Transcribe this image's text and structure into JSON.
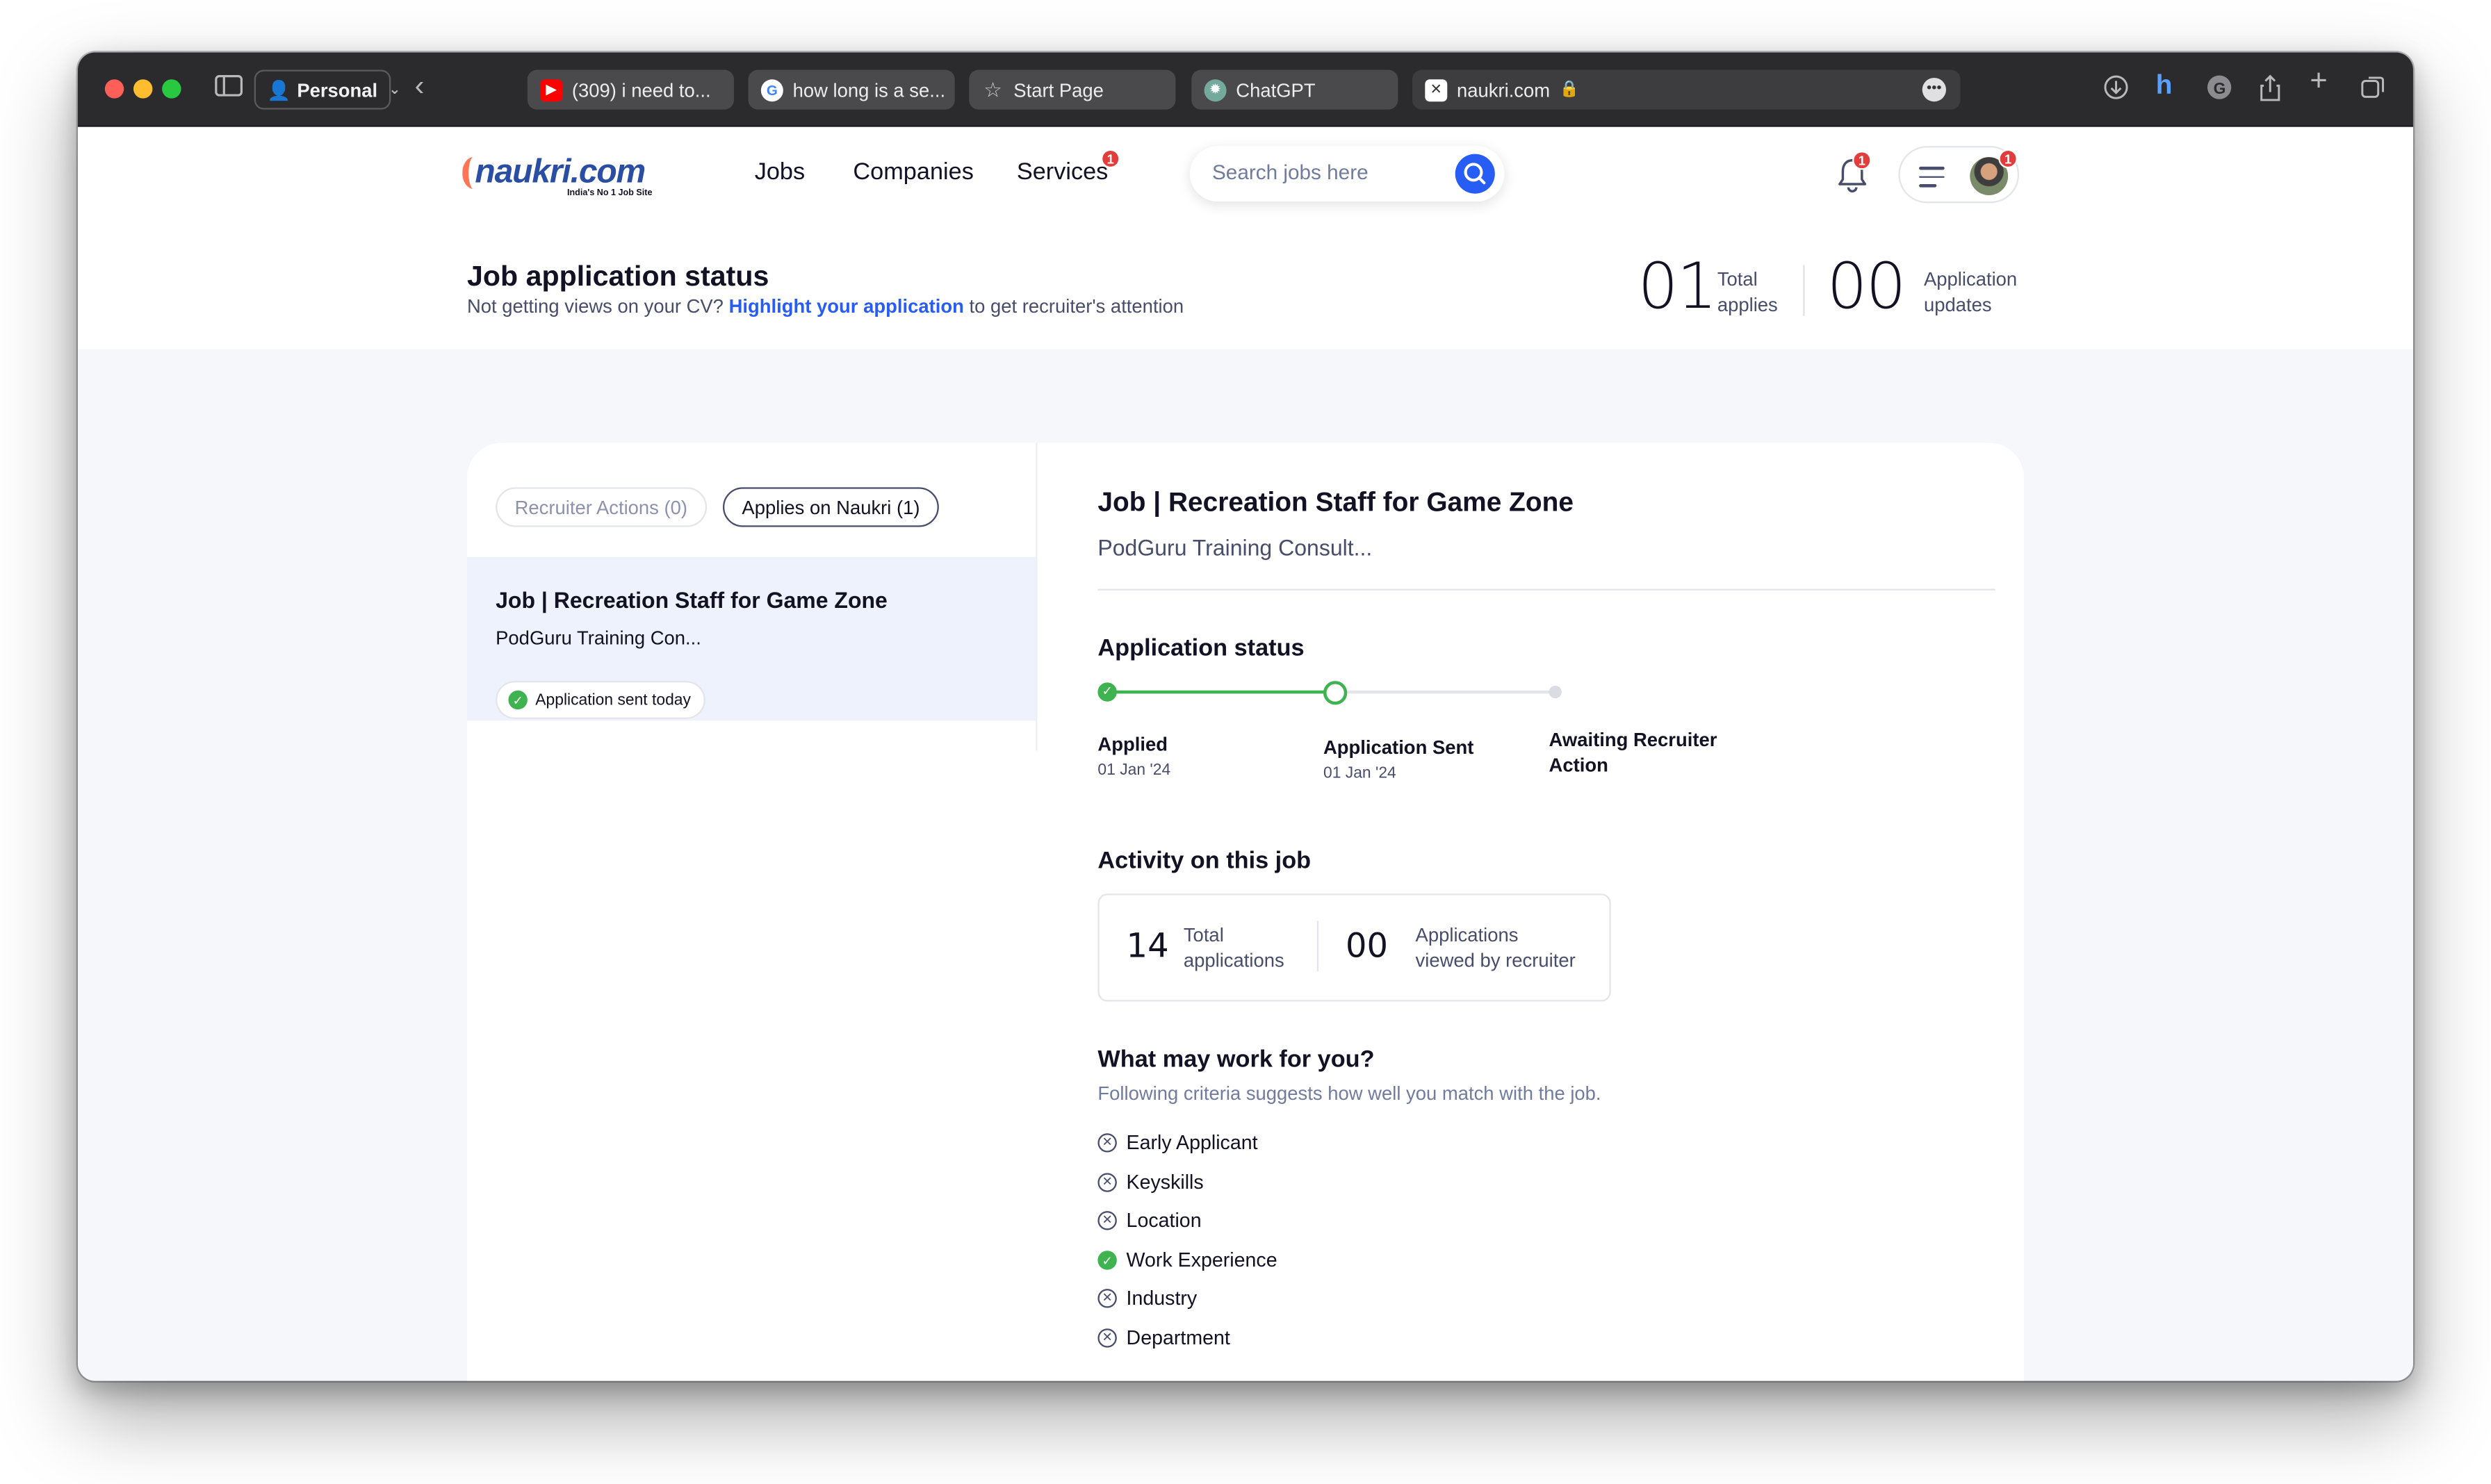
{
  "browser": {
    "profile_label": "Personal",
    "tabs": [
      {
        "label": "(309) i need to...",
        "icon": "youtube-icon",
        "color": "#ff0000"
      },
      {
        "label": "how long is a se...",
        "icon": "google-icon",
        "color": "#ffffff"
      },
      {
        "label": "Start Page",
        "icon": "star-icon",
        "color": "#bbbbbb"
      },
      {
        "label": "ChatGPT",
        "icon": "chatgpt-icon",
        "color": "#74aa9c"
      }
    ],
    "active_tab": {
      "label": "naukri.com",
      "icon": "naukri-favicon"
    }
  },
  "header": {
    "logo_text": "naukri",
    "logo_dot": ".com",
    "logo_tagline": "India's No 1 Job Site",
    "nav": [
      {
        "label": "Jobs"
      },
      {
        "label": "Companies"
      },
      {
        "label": "Services",
        "badge": "1"
      }
    ],
    "search_placeholder": "Search jobs here",
    "bell_badge": "1",
    "menu_badge": "1",
    "accent_color": "#275df5"
  },
  "status_header": {
    "title": "Job application status",
    "subtitle_pre": "Not getting views on your CV?",
    "subtitle_link": "Highlight your application",
    "subtitle_post": "to get recruiter's attention",
    "total_applies_value": "01",
    "total_applies_label1": "Total",
    "total_applies_label2": "applies",
    "updates_value": "00",
    "updates_label1": "Application",
    "updates_label2": "updates"
  },
  "filters": {
    "recruiter_actions": "Recruiter Actions (0)",
    "applies_on_naukri": "Applies on Naukri (1)"
  },
  "application_item": {
    "title": "Job | Recreation Staff for Game Zone",
    "company": "PodGuru Training Con...",
    "status": "Application sent today"
  },
  "detail": {
    "title": "Job | Recreation Staff for Game Zone",
    "company": "PodGuru Training Consult...",
    "status_title": "Application status",
    "steps": [
      {
        "label": "Applied",
        "date": "01 Jan '24"
      },
      {
        "label": "Application Sent",
        "date": "01 Jan '24"
      },
      {
        "label1": "Awaiting Recruiter",
        "label2": "Action"
      }
    ],
    "activity_title": "Activity on this job",
    "activity": {
      "total_value": "14",
      "total_label1": "Total",
      "total_label2": "applications",
      "viewed_value": "00",
      "viewed_label1": "Applications",
      "viewed_label2": "viewed by recruiter"
    },
    "match_title": "What may work for you?",
    "match_subtitle": "Following criteria suggests how well you match with the job.",
    "criteria": [
      {
        "label": "Early Applicant",
        "met": false
      },
      {
        "label": "Keyskills",
        "met": false
      },
      {
        "label": "Location",
        "met": false
      },
      {
        "label": "Work Experience",
        "met": true
      },
      {
        "label": "Industry",
        "met": false
      },
      {
        "label": "Department",
        "met": false
      }
    ]
  }
}
